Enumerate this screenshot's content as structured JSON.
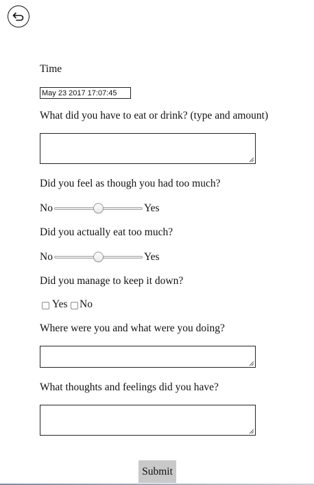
{
  "back_button": {
    "icon": "back-arrow-icon"
  },
  "form": {
    "time": {
      "label": "Time",
      "value": "May 23 2017 17:07:45"
    },
    "food": {
      "label": "What did you have to eat or drink? (type and amount)",
      "value": ""
    },
    "felt_too_much": {
      "label": "Did you feel as though you had too much?",
      "min_label": "No",
      "max_label": "Yes",
      "value": 0.5
    },
    "ate_too_much": {
      "label": "Did you actually eat too much?",
      "min_label": "No",
      "max_label": "Yes",
      "value": 0.5
    },
    "kept_down": {
      "label": "Did you manage to keep it down?",
      "options": [
        {
          "label": "Yes",
          "checked": false
        },
        {
          "label": "No",
          "checked": false
        }
      ]
    },
    "where": {
      "label": "Where were you and what were you doing?",
      "value": ""
    },
    "thoughts": {
      "label": "What thoughts and feelings did you have?",
      "value": ""
    },
    "submit_label": "Submit"
  }
}
